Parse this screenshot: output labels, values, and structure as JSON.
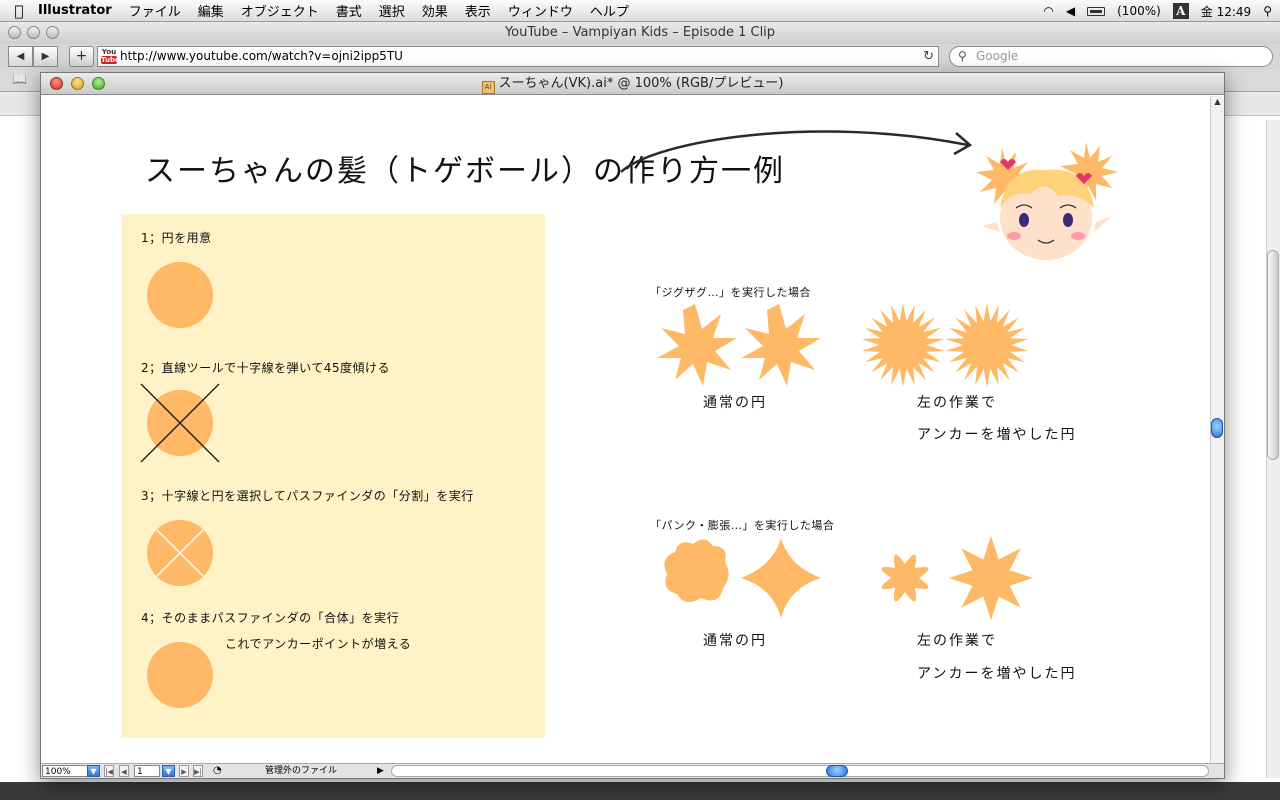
{
  "menubar": {
    "app_name": "Illustrator",
    "items": [
      "ファイル",
      "編集",
      "オブジェクト",
      "書式",
      "選択",
      "効果",
      "表示",
      "ウィンドウ",
      "ヘルプ"
    ],
    "battery": "(100%)",
    "input_method": "A",
    "clock": "金 12:49"
  },
  "browser": {
    "window_title": "YouTube – Vampiyan Kids – Episode 1 Clip",
    "url": "http://www.youtube.com/watch?v=ojni2ipp5TU",
    "search_placeholder": "Google",
    "favicon_top": "You",
    "favicon_bottom": "Tube"
  },
  "illustrator": {
    "window_title": "スーちゃん(VK).ai* @ 100% (RGB/プレビュー)",
    "doc_icon": "Ai",
    "zoom": "100%",
    "page": "1",
    "status_text": "管理外のファイル"
  },
  "artwork": {
    "title": "スーちゃんの髪（トゲボール）の作り方一例",
    "steps": [
      {
        "label": "1；円を用意"
      },
      {
        "label": "2；直線ツールで十字線を弾いて45度傾ける"
      },
      {
        "label": "3；十字線と円を選択してパスファインダの「分割」を実行"
      },
      {
        "label": "4；そのままパスファインダの「合体」を実行"
      }
    ],
    "step4_note": "これでアンカーポイントが増える",
    "section_zigzag": "「ジグザグ…」を実行した場合",
    "section_pucker": "「パンク・膨張…」を実行した場合",
    "caption_normal": "通常の円",
    "caption_added_1": "左の作業で",
    "caption_added_2": "アンカーを増やした円",
    "shape_color": "#ffb865",
    "panel_color": "#fff2c6"
  }
}
